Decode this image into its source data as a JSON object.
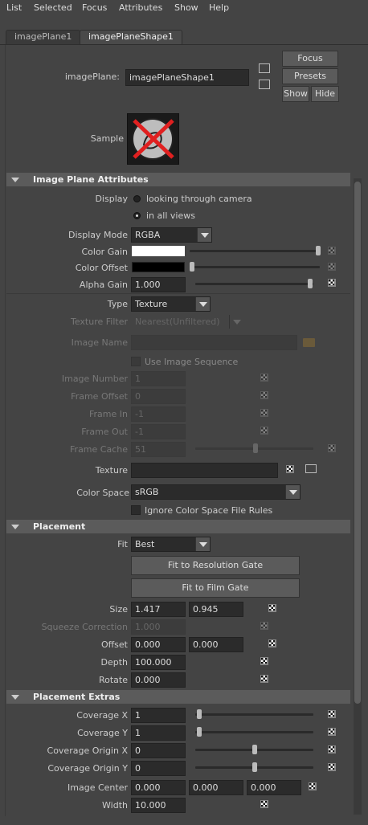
{
  "menu": [
    "List",
    "Selected",
    "Focus",
    "Attributes",
    "Show",
    "Help"
  ],
  "tabs": [
    "imagePlane1",
    "imagePlaneShape1"
  ],
  "header": {
    "node_label": "imagePlane:",
    "node_value": "imagePlaneShape1",
    "focus": "Focus",
    "presets": "Presets",
    "show": "Show",
    "hide": "Hide",
    "sample_label": "Sample"
  },
  "image_plane_attributes": {
    "title": "Image Plane Attributes",
    "display_label": "Display",
    "display_opt1": "looking through camera",
    "display_opt2": "in all views",
    "display_mode_label": "Display Mode",
    "display_mode": "RGBA",
    "color_gain_label": "Color Gain",
    "color_gain": 1,
    "color_offset_label": "Color Offset",
    "color_offset": 0,
    "alpha_gain_label": "Alpha Gain",
    "alpha_gain": "1.000",
    "type_label": "Type",
    "type": "Texture",
    "texture_filter_label": "Texture Filter",
    "texture_filter": "Nearest(Unfiltered)",
    "image_name_label": "Image Name",
    "use_image_sequence": "Use Image Sequence",
    "image_number_label": "Image Number",
    "image_number": "1",
    "frame_offset_label": "Frame Offset",
    "frame_offset": "0",
    "frame_in_label": "Frame In",
    "frame_in": "-1",
    "frame_out_label": "Frame Out",
    "frame_out": "-1",
    "frame_cache_label": "Frame Cache",
    "frame_cache": "51",
    "texture_label": "Texture",
    "color_space_label": "Color Space",
    "color_space": "sRGB",
    "ignore_cs": "Ignore Color Space File Rules"
  },
  "placement": {
    "title": "Placement",
    "fit_label": "Fit",
    "fit": "Best",
    "fit_res_gate": "Fit to Resolution Gate",
    "fit_film_gate": "Fit to Film Gate",
    "size_label": "Size",
    "size_x": "1.417",
    "size_y": "0.945",
    "squeeze_label": "Squeeze Correction",
    "squeeze": "1.000",
    "offset_label": "Offset",
    "offset_x": "0.000",
    "offset_y": "0.000",
    "depth_label": "Depth",
    "depth": "100.000",
    "rotate_label": "Rotate",
    "rotate": "0.000"
  },
  "placement_extras": {
    "title": "Placement Extras",
    "coverage_x_label": "Coverage X",
    "coverage_x": "1",
    "coverage_y_label": "Coverage Y",
    "coverage_y": "1",
    "cov_origin_x_label": "Coverage Origin X",
    "cov_origin_x": "0",
    "cov_origin_y_label": "Coverage Origin Y",
    "cov_origin_y": "0",
    "image_center_label": "Image Center",
    "ic_x": "0.000",
    "ic_y": "0.000",
    "ic_z": "0.000",
    "width_label": "Width",
    "width": "10.000"
  },
  "colors": {
    "accent_red": "#e02020",
    "panel": "#444444",
    "field": "#2b2b2b"
  }
}
